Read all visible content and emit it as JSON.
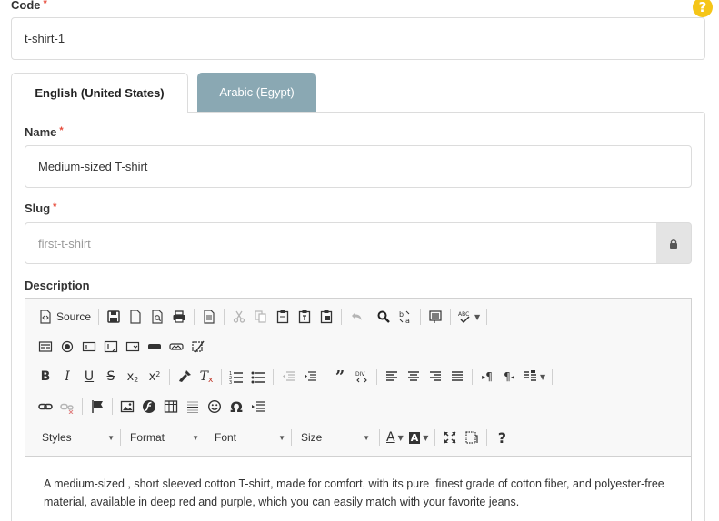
{
  "code": {
    "label": "Code",
    "required_mark": "*",
    "value": "t-shirt-1"
  },
  "help_icon": "?",
  "tabs": [
    {
      "label": "English (United States)",
      "active": true
    },
    {
      "label": "Arabic (Egypt)",
      "active": false
    }
  ],
  "name": {
    "label": "Name",
    "required_mark": "*",
    "value": "Medium-sized T-shirt"
  },
  "slug": {
    "label": "Slug",
    "required_mark": "*",
    "placeholder": "first-t-shirt",
    "lock_icon": "lock-icon"
  },
  "description": {
    "label": "Description",
    "toolbar": {
      "source_label": "Source",
      "styles_label": "Styles",
      "format_label": "Format",
      "font_label": "Font",
      "size_label": "Size",
      "help_glyph": "?",
      "italic_glyph": "I",
      "bold_glyph": "B",
      "underline_glyph": "U",
      "strike_glyph": "S",
      "text_color_glyph": "A",
      "bg_color_glyph": "A"
    },
    "content": "A medium-sized , short sleeved cotton T-shirt, made for comfort, with its pure ,finest grade of cotton fiber, and polyester-free material, available in deep red and purple, which you can easily match with your favorite jeans."
  }
}
